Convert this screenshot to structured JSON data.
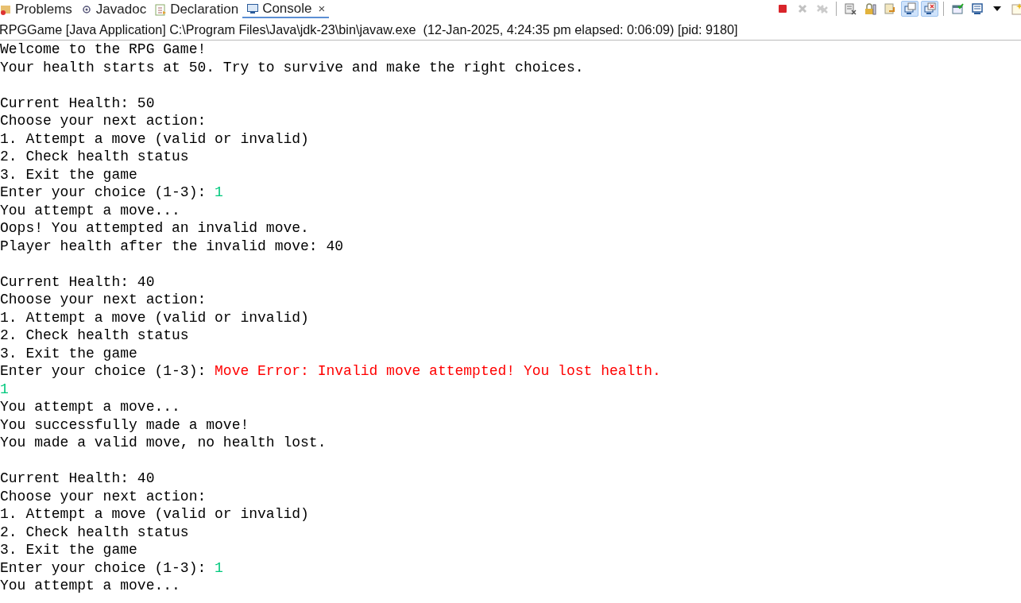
{
  "tabs": [
    {
      "label": "Problems",
      "selected": false
    },
    {
      "label": "Javadoc",
      "selected": false
    },
    {
      "label": "Declaration",
      "selected": false
    },
    {
      "label": "Console",
      "selected": true,
      "close": "×"
    }
  ],
  "toolbar": [
    {
      "kind": "terminate",
      "disabled": false,
      "pressed": false
    },
    {
      "kind": "remove",
      "disabled": true,
      "pressed": false
    },
    {
      "kind": "remove-all",
      "disabled": true,
      "pressed": false
    },
    {
      "kind": "clear",
      "disabled": false,
      "pressed": false
    },
    {
      "kind": "lock",
      "disabled": false,
      "pressed": false
    },
    {
      "kind": "wrap",
      "disabled": false,
      "pressed": false
    },
    {
      "kind": "stdout",
      "disabled": false,
      "pressed": true
    },
    {
      "kind": "stderr",
      "disabled": false,
      "pressed": true
    },
    {
      "kind": "pin",
      "disabled": false,
      "pressed": false
    },
    {
      "kind": "display",
      "disabled": false,
      "pressed": false
    },
    {
      "kind": "menu",
      "disabled": false,
      "pressed": false
    },
    {
      "kind": "new",
      "disabled": false,
      "pressed": false
    }
  ],
  "console": {
    "header": "RPGGame [Java Application] C:\\Program Files\\Java\\jdk-23\\bin\\javaw.exe  (12-Jan-2025, 4:24:35 pm elapsed: 0:06:09) [pid: 9180]",
    "blocks": [
      [
        [
          {
            "kind": "output",
            "text": "Welcome to the RPG Game!"
          }
        ],
        [
          {
            "kind": "output",
            "text": "Your health starts at 50. Try to survive and make the right choices."
          }
        ]
      ],
      [
        [
          {
            "kind": "output",
            "text": "Current Health: 50"
          }
        ],
        [
          {
            "kind": "output",
            "text": "Choose your next action:"
          }
        ],
        [
          {
            "kind": "output",
            "text": "1. Attempt a move (valid or invalid)"
          }
        ],
        [
          {
            "kind": "output",
            "text": "2. Check health status"
          }
        ],
        [
          {
            "kind": "output",
            "text": "3. Exit the game"
          }
        ],
        [
          {
            "kind": "output",
            "text": "Enter your choice (1-3): "
          },
          {
            "kind": "input",
            "text": "1"
          }
        ],
        [
          {
            "kind": "output",
            "text": "You attempt a move..."
          }
        ],
        [
          {
            "kind": "output",
            "text": "Oops! You attempted an invalid move."
          }
        ],
        [
          {
            "kind": "output",
            "text": "Player health after the invalid move: 40"
          }
        ]
      ],
      [
        [
          {
            "kind": "output",
            "text": "Current Health: 40"
          }
        ],
        [
          {
            "kind": "output",
            "text": "Choose your next action:"
          }
        ],
        [
          {
            "kind": "output",
            "text": "1. Attempt a move (valid or invalid)"
          }
        ],
        [
          {
            "kind": "output",
            "text": "2. Check health status"
          }
        ],
        [
          {
            "kind": "output",
            "text": "3. Exit the game"
          }
        ],
        [
          {
            "kind": "output",
            "text": "Enter your choice (1-3): "
          },
          {
            "kind": "error",
            "text": "Move Error: Invalid move attempted! You lost health."
          }
        ],
        [
          {
            "kind": "input",
            "text": "1"
          }
        ],
        [
          {
            "kind": "output",
            "text": "You attempt a move..."
          }
        ],
        [
          {
            "kind": "output",
            "text": "You successfully made a move!"
          }
        ],
        [
          {
            "kind": "output",
            "text": "You made a valid move, no health lost."
          }
        ]
      ],
      [
        [
          {
            "kind": "output",
            "text": "Current Health: 40"
          }
        ],
        [
          {
            "kind": "output",
            "text": "Choose your next action:"
          }
        ],
        [
          {
            "kind": "output",
            "text": "1. Attempt a move (valid or invalid)"
          }
        ],
        [
          {
            "kind": "output",
            "text": "2. Check health status"
          }
        ],
        [
          {
            "kind": "output",
            "text": "3. Exit the game"
          }
        ],
        [
          {
            "kind": "output",
            "text": "Enter your choice (1-3): "
          },
          {
            "kind": "input",
            "text": "1"
          }
        ],
        [
          {
            "kind": "output",
            "text": "You attempt a move..."
          }
        ]
      ]
    ]
  }
}
